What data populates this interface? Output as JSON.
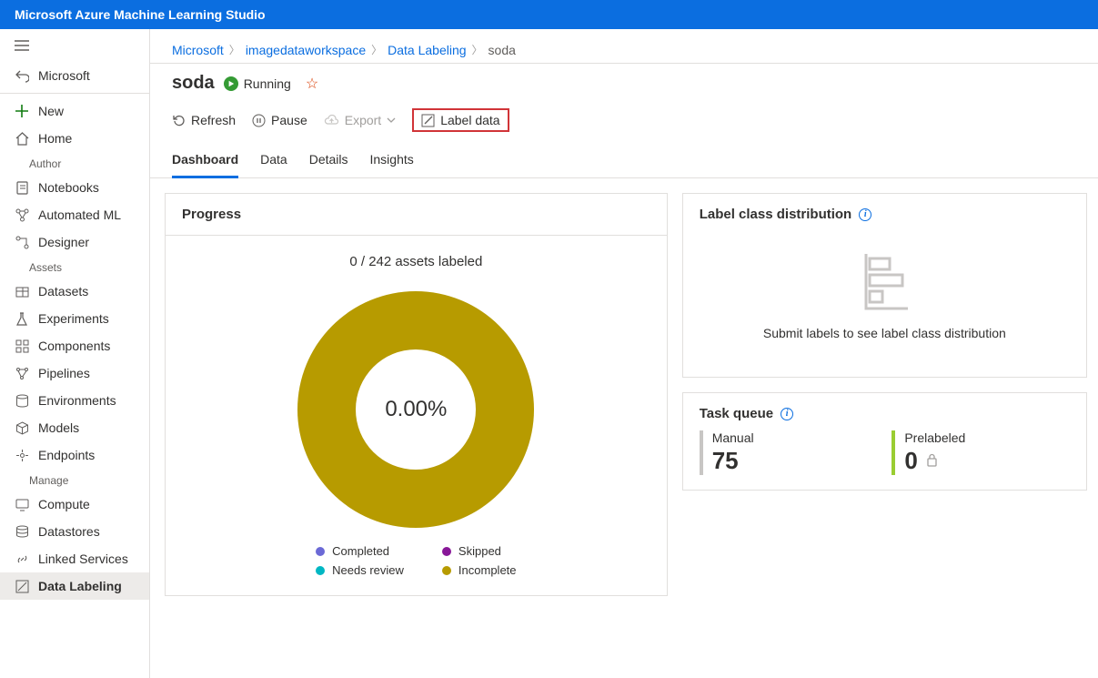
{
  "topbar": {
    "title": "Microsoft Azure Machine Learning Studio"
  },
  "sidebar": {
    "back_label": "Microsoft",
    "new_label": "New",
    "home_label": "Home",
    "section_author": "Author",
    "notebooks": "Notebooks",
    "automated_ml": "Automated ML",
    "designer": "Designer",
    "section_assets": "Assets",
    "datasets": "Datasets",
    "experiments": "Experiments",
    "components": "Components",
    "pipelines": "Pipelines",
    "environments": "Environments",
    "models": "Models",
    "endpoints": "Endpoints",
    "section_manage": "Manage",
    "compute": "Compute",
    "datastores": "Datastores",
    "linked_services": "Linked Services",
    "data_labeling": "Data Labeling"
  },
  "breadcrumbs": {
    "microsoft": "Microsoft",
    "workspace": "imagedataworkspace",
    "data_labeling": "Data Labeling",
    "current": "soda"
  },
  "title": {
    "name": "soda",
    "status": "Running"
  },
  "toolbar": {
    "refresh": "Refresh",
    "pause": "Pause",
    "export": "Export",
    "label_data": "Label data"
  },
  "tabs": {
    "dashboard": "Dashboard",
    "data": "Data",
    "details": "Details",
    "insights": "Insights"
  },
  "progress": {
    "header": "Progress",
    "summary": "0 / 242 assets labeled",
    "percent": "0.00%",
    "legend": {
      "completed": "Completed",
      "needs_review": "Needs review",
      "skipped": "Skipped",
      "incomplete": "Incomplete"
    }
  },
  "distribution": {
    "header": "Label class distribution",
    "empty_msg": "Submit labels to see label class distribution"
  },
  "queue": {
    "header": "Task queue",
    "manual_label": "Manual",
    "manual_value": "75",
    "prelabeled_label": "Prelabeled",
    "prelabeled_value": "0"
  },
  "chart_data": {
    "type": "pie",
    "title": "Progress",
    "series": [
      {
        "name": "Completed",
        "value": 0,
        "color": "#6b69d6"
      },
      {
        "name": "Needs review",
        "value": 0,
        "color": "#00b7c3"
      },
      {
        "name": "Skipped",
        "value": 0,
        "color": "#881798"
      },
      {
        "name": "Incomplete",
        "value": 242,
        "color": "#b79b00"
      }
    ],
    "total": 242,
    "center_label": "0.00%"
  }
}
